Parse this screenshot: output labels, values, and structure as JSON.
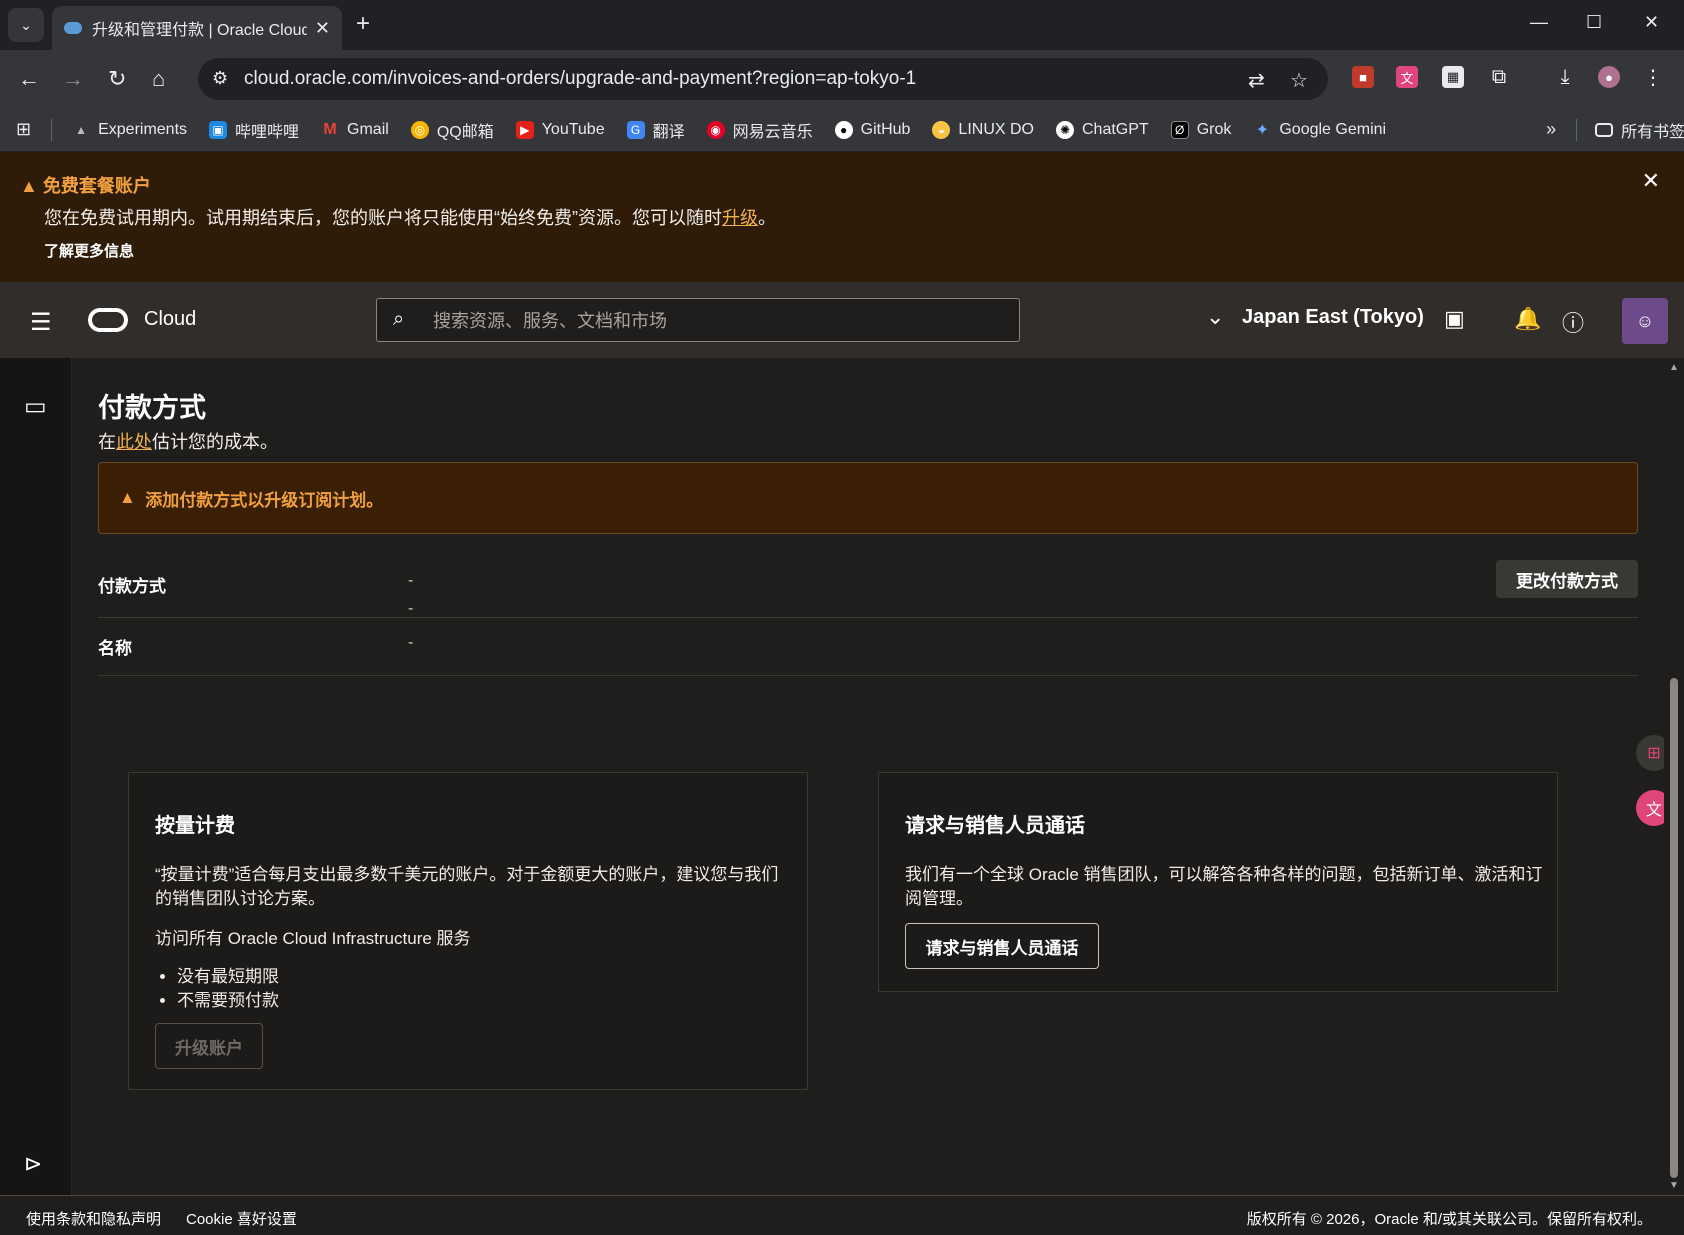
{
  "browser": {
    "tab_title": "升级和管理付款 | Oracle Cloud",
    "url": "cloud.oracle.com/invoices-and-orders/upgrade-and-payment?region=ap-tokyo-1",
    "bookmarks": [
      "Experiments",
      "哔哩哔哩",
      "Gmail",
      "QQ邮箱",
      "YouTube",
      "翻译",
      "网易云音乐",
      "GitHub",
      "LINUX DO",
      "ChatGPT",
      "Grok",
      "Google Gemini"
    ],
    "all_bookmarks": "所有书签"
  },
  "banner": {
    "title": "免费套餐账户",
    "text_before": "您在免费试用期内。试用期结束后，您的账户将只能使用“始终免费”资源。您可以随时",
    "link": "升级",
    "text_after": "。",
    "learn_more": "了解更多信息"
  },
  "header": {
    "brand": "Cloud",
    "search_placeholder": "搜索资源、服务、文档和市场",
    "region": "Japan East (Tokyo)"
  },
  "page": {
    "title": "付款方式",
    "subtitle_before": "在",
    "subtitle_link": "此处",
    "subtitle_after": "估计您的成本。",
    "warning": "添加付款方式以升级订阅计划。",
    "payment_label": "付款方式",
    "payment_value_1": "-",
    "payment_value_2": "-",
    "change_button": "更改付款方式",
    "name_label": "名称",
    "name_value": "-"
  },
  "cards": {
    "payg": {
      "title": "按量计费",
      "desc": "“按量计费”适合每月支出最多数千美元的账户。对于金额更大的账户，建议您与我们的销售团队讨论方案。",
      "access": "访问所有 Oracle Cloud Infrastructure 服务",
      "bullets": [
        "没有最短期限",
        "不需要预付款"
      ],
      "button": "升级账户"
    },
    "sales": {
      "title": "请求与销售人员通话",
      "desc": "我们有一个全球 Oracle 销售团队，可以解答各种各样的问题，包括新订单、激活和订阅管理。",
      "button": "请求与销售人员通话"
    }
  },
  "footer": {
    "terms": "使用条款和隐私声明",
    "cookie": "Cookie 喜好设置",
    "copyright": "版权所有 © 2026，Oracle 和/或其关联公司。保留所有权利。"
  }
}
